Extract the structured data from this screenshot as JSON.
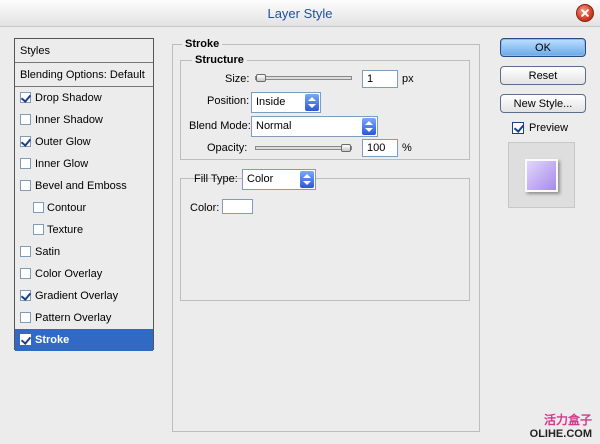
{
  "window": {
    "title": "Layer Style"
  },
  "styles_panel": {
    "header": "Styles",
    "blending": "Blending Options: Default",
    "items": [
      {
        "label": "Drop Shadow",
        "checked": true
      },
      {
        "label": "Inner Shadow",
        "checked": false
      },
      {
        "label": "Outer Glow",
        "checked": true
      },
      {
        "label": "Inner Glow",
        "checked": false
      },
      {
        "label": "Bevel and Emboss",
        "checked": false
      },
      {
        "label": "Contour",
        "checked": false
      },
      {
        "label": "Texture",
        "checked": false
      },
      {
        "label": "Satin",
        "checked": false
      },
      {
        "label": "Color Overlay",
        "checked": false
      },
      {
        "label": "Gradient Overlay",
        "checked": true
      },
      {
        "label": "Pattern Overlay",
        "checked": false
      },
      {
        "label": "Stroke",
        "checked": true
      }
    ]
  },
  "stroke": {
    "title": "Stroke",
    "structure": "Structure",
    "size_label": "Size:",
    "size_value": "1",
    "size_unit": "px",
    "size_slider_fraction": 0.0,
    "position_label": "Position:",
    "position_value": "Inside",
    "blend_label": "Blend Mode:",
    "blend_value": "Normal",
    "opacity_label": "Opacity:",
    "opacity_value": "100",
    "opacity_unit": "%",
    "opacity_slider_fraction": 1.0,
    "fill_type_label": "Fill Type:",
    "fill_type_value": "Color",
    "color_label": "Color:",
    "color_value": "#ffffff"
  },
  "buttons": {
    "ok": "OK",
    "reset": "Reset",
    "new_style": "New Style...",
    "preview": "Preview",
    "preview_checked": true
  },
  "watermark": {
    "line1": "活力盒子",
    "line2": "OLIHE.COM"
  }
}
